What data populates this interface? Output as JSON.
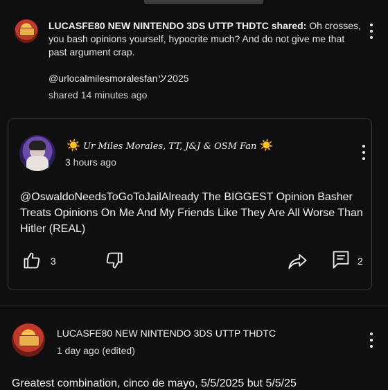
{
  "shared_post": {
    "author": "LUCASFE80 NEW NINTENDO 3DS UTTP THDTC shared:",
    "message": "Oh crosses, you bash opinions yourself, hypocrite much? And do not give me that past argument crap.",
    "mention": "@urlocalmilesmoralesfanツ2025",
    "time": "shared 14 minutes ago"
  },
  "original_comment": {
    "sun_left": "☀️",
    "author": "Ur Miles Morales, TT, J&J & OSM Fan",
    "sun_right": "☀️",
    "time": "3 hours ago",
    "body": "@OswaldoNeedsToGoToJailAlready The BIGGEST Opinion Basher Treats Opinions On Me And My Friends Like They Are All Worse Than Hitler (REAL)",
    "like_count": "3",
    "reply_count": "2"
  },
  "next_comment": {
    "author": "LUCASFE80 NEW NINTENDO 3DS UTTP THDTC",
    "time": "1 day ago (edited)",
    "body": "Greatest combination, cinco de mayo, 5/5/2025 but 5/5/25"
  },
  "icons": {
    "more": "more-vert-icon",
    "like": "thumb-up-icon",
    "dislike": "thumb-down-icon",
    "share": "share-icon",
    "reply": "comment-icon"
  }
}
